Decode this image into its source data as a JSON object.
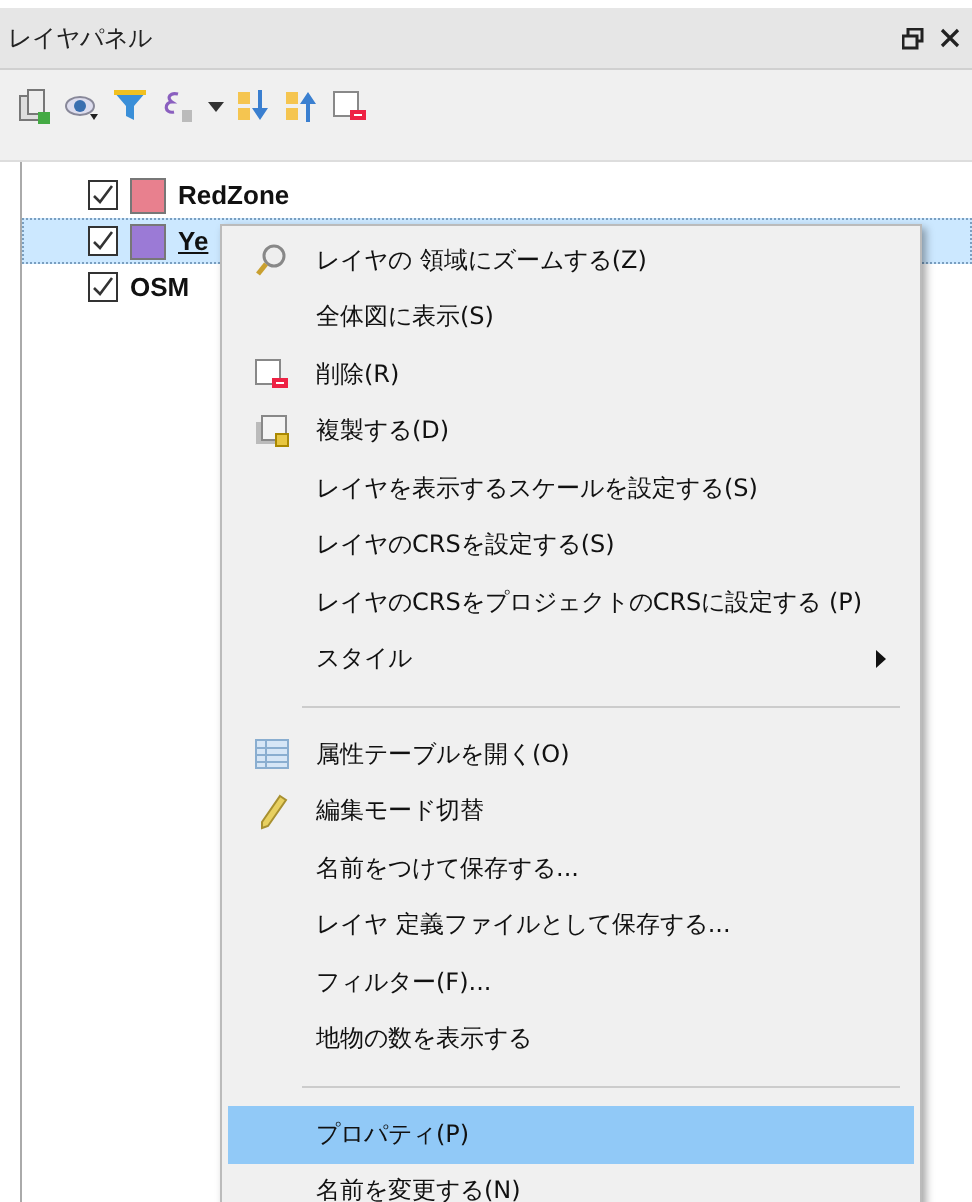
{
  "panel": {
    "title": "レイヤパネル"
  },
  "layers": [
    {
      "name": "RedZone",
      "checked": true,
      "color": "#e8808e",
      "selected": false
    },
    {
      "name": "Ye",
      "checked": true,
      "color": "#9b7ad6",
      "selected": true
    },
    {
      "name": "OSM",
      "checked": true,
      "selected": false
    }
  ],
  "context_menu": {
    "items": [
      {
        "kind": "item",
        "label": "レイヤの 領域にズームする(Z)",
        "selected": false
      },
      {
        "kind": "item",
        "label": "全体図に表示(S)",
        "selected": false
      },
      {
        "kind": "item",
        "label": "削除(R)",
        "selected": false
      },
      {
        "kind": "item",
        "label": "複製する(D)",
        "selected": false
      },
      {
        "kind": "item",
        "label": "レイヤを表示するスケールを設定する(S)",
        "selected": false
      },
      {
        "kind": "item",
        "label": "レイヤのCRSを設定する(S)",
        "selected": false
      },
      {
        "kind": "item",
        "label": "レイヤのCRSをプロジェクトのCRSに設定する (P)",
        "selected": false
      },
      {
        "kind": "submenu",
        "label": "スタイル",
        "selected": false
      },
      {
        "kind": "separator"
      },
      {
        "kind": "item",
        "label": "属性テーブルを開く(O)",
        "selected": false
      },
      {
        "kind": "item",
        "label": "編集モード切替",
        "selected": false
      },
      {
        "kind": "item",
        "label": "名前をつけて保存する...",
        "selected": false
      },
      {
        "kind": "item",
        "label": "レイヤ 定義ファイルとして保存する...",
        "selected": false
      },
      {
        "kind": "item",
        "label": "フィルター(F)...",
        "selected": false
      },
      {
        "kind": "item",
        "label": "地物の数を表示する",
        "selected": false
      },
      {
        "kind": "separator"
      },
      {
        "kind": "item",
        "label": "プロパティ(P)",
        "selected": true
      },
      {
        "kind": "item",
        "label": "名前を変更する(N)",
        "selected": false
      }
    ]
  }
}
